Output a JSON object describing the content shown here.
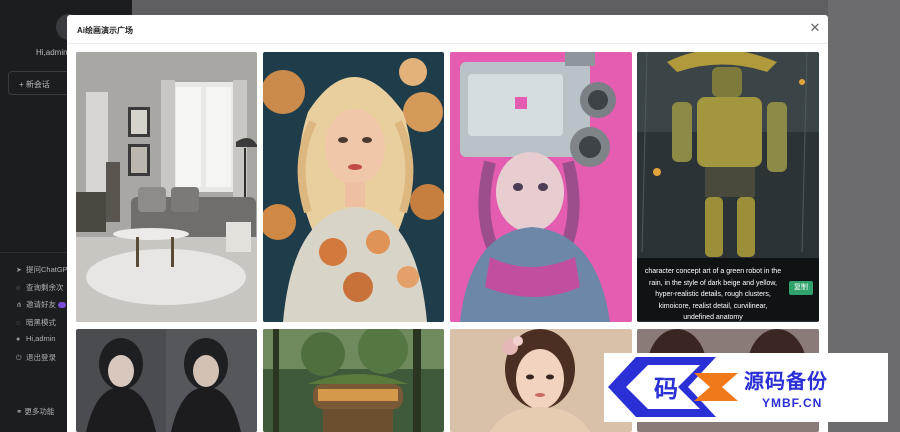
{
  "sidebar": {
    "greeting": "Hi,admin",
    "new_chat": "+ 新会话",
    "menu": [
      {
        "icon": "send-icon",
        "label": "提问ChatGP"
      },
      {
        "icon": "search-icon",
        "label": "查询剩余次"
      },
      {
        "icon": "share-icon",
        "label": "邀请好友"
      },
      {
        "icon": "moon-icon",
        "label": "暗黑模式"
      },
      {
        "icon": "user-icon",
        "label": "Hi,admin"
      },
      {
        "icon": "logout-icon",
        "label": "退出登录"
      }
    ],
    "more": "更多功能"
  },
  "modal": {
    "title": "Ai绘画演示广场",
    "close_symbol": "✕",
    "featured_prompt": "character concept art of a green robot in the rain, in the style of dark beige and yellow, hyper-realistic details, rough clusters, kimoicore, realist detail, curvilinear, undefined anatomy",
    "copy_label": "复制"
  },
  "gallery": [
    {
      "name": "gallery-image-living-room",
      "subject": "living room"
    },
    {
      "name": "gallery-image-blonde-woman",
      "subject": "blonde woman with flowers"
    },
    {
      "name": "gallery-image-tv-head-girl",
      "subject": "girl with tv head"
    },
    {
      "name": "gallery-image-green-robot",
      "subject": "robot in rain"
    },
    {
      "name": "gallery-image-dark-women",
      "subject": "two women dark"
    },
    {
      "name": "gallery-image-forest-house",
      "subject": "house in forest"
    },
    {
      "name": "gallery-image-asian-woman",
      "subject": "asian woman portrait"
    },
    {
      "name": "gallery-image-women-portrait",
      "subject": "women portrait"
    }
  ],
  "watermark": {
    "glyph": "码",
    "title": "源码备份",
    "url": "YMBF.CN"
  },
  "colors": {
    "sidebar_bg": "#1c1d20",
    "copy_button": "#2fa36b",
    "watermark_blue": "#2b2fd6",
    "watermark_orange": "#f07a1a"
  }
}
